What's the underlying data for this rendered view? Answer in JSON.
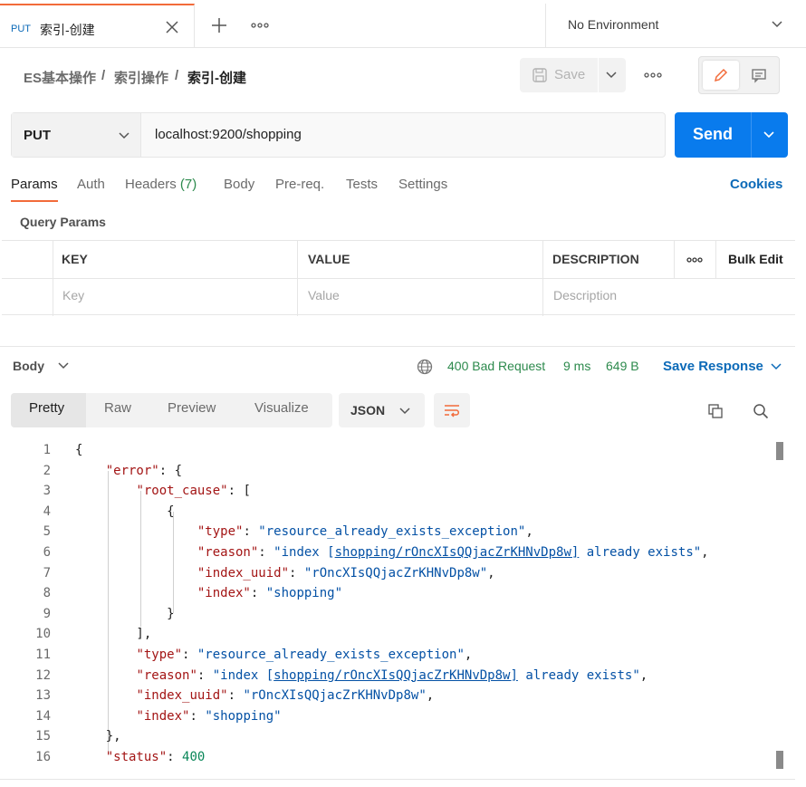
{
  "tab": {
    "method": "PUT",
    "name": "索引-创建"
  },
  "environment": {
    "name": "No Environment"
  },
  "breadcrumb": {
    "items": [
      "ES基本操作",
      "索引操作",
      "索引-创建"
    ],
    "sep": "/"
  },
  "toolbar": {
    "save_label": "Save"
  },
  "request": {
    "method": "PUT",
    "url": "localhost:9200/shopping",
    "send_label": "Send"
  },
  "request_tabs": [
    {
      "label": "Params",
      "active": true
    },
    {
      "label": "Auth"
    },
    {
      "label": "Headers",
      "count": "(7)"
    },
    {
      "label": "Body"
    },
    {
      "label": "Pre-req."
    },
    {
      "label": "Tests"
    },
    {
      "label": "Settings"
    }
  ],
  "cookies_label": "Cookies",
  "query_params": {
    "title": "Query Params",
    "headers": [
      "KEY",
      "VALUE",
      "DESCRIPTION"
    ],
    "bulk_edit": "Bulk Edit",
    "placeholders": [
      "Key",
      "Value",
      "Description"
    ]
  },
  "response": {
    "label": "Body",
    "status": "400 Bad Request",
    "time": "9 ms",
    "size": "649 B",
    "save_label": "Save Response",
    "view_tabs": [
      "Pretty",
      "Raw",
      "Preview",
      "Visualize"
    ],
    "format": "JSON"
  },
  "code_lines": [
    {
      "n": 1,
      "html": "{"
    },
    {
      "n": 2,
      "html": "    <span class=\"k\">\"error\"</span>: {"
    },
    {
      "n": 3,
      "html": "        <span class=\"k\">\"root_cause\"</span>: ["
    },
    {
      "n": 4,
      "html": "            {"
    },
    {
      "n": 5,
      "html": "                <span class=\"k\">\"type\"</span>: <span class=\"s\">\"resource_already_exists_exception\"</span>,"
    },
    {
      "n": 6,
      "html": "                <span class=\"k\">\"reason\"</span>: <span class=\"s\">\"index [<span class=\"u\">shopping/rOncXIsQQjacZrKHNvDp8w]</span> already exists\"</span>,"
    },
    {
      "n": 7,
      "html": "                <span class=\"k\">\"index_uuid\"</span>: <span class=\"s\">\"rOncXIsQQjacZrKHNvDp8w\"</span>,"
    },
    {
      "n": 8,
      "html": "                <span class=\"k\">\"index\"</span>: <span class=\"s\">\"shopping\"</span>"
    },
    {
      "n": 9,
      "html": "            }"
    },
    {
      "n": 10,
      "html": "        ],"
    },
    {
      "n": 11,
      "html": "        <span class=\"k\">\"type\"</span>: <span class=\"s\">\"resource_already_exists_exception\"</span>,"
    },
    {
      "n": 12,
      "html": "        <span class=\"k\">\"reason\"</span>: <span class=\"s\">\"index [<span class=\"u\">shopping/rOncXIsQQjacZrKHNvDp8w]</span> already exists\"</span>,"
    },
    {
      "n": 13,
      "html": "        <span class=\"k\">\"index_uuid\"</span>: <span class=\"s\">\"rOncXIsQQjacZrKHNvDp8w\"</span>,"
    },
    {
      "n": 14,
      "html": "        <span class=\"k\">\"index\"</span>: <span class=\"s\">\"shopping\"</span>"
    },
    {
      "n": 15,
      "html": "    },"
    },
    {
      "n": 16,
      "html": "    <span class=\"k\">\"status\"</span>: <span class=\"n\">400</span>"
    }
  ],
  "colors": {
    "accent": "#f26b3a",
    "send": "#097bed",
    "status_ok": "#2d8a4d",
    "link": "#0c6ab8"
  }
}
